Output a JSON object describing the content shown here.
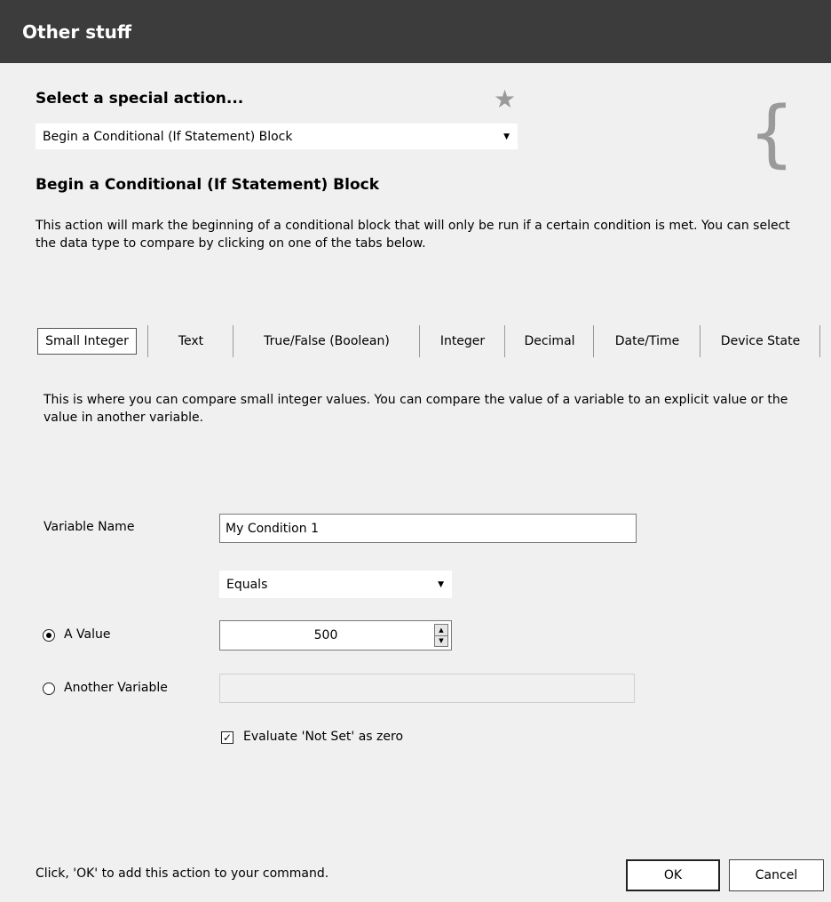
{
  "window": {
    "title": "Other stuff"
  },
  "action_select": {
    "heading": "Select a special action...",
    "value": "Begin a Conditional (If Statement) Block",
    "favorite_icon": "star-icon",
    "category_icon": "brace-icon",
    "category_glyph": "{"
  },
  "action": {
    "title": "Begin a Conditional (If Statement) Block",
    "description": "This action will mark the beginning of a conditional block that will only be run if a certain condition is met.  You can select the data type to compare by clicking on one of the tabs below."
  },
  "tabs": [
    {
      "label": "Small Integer",
      "active": true
    },
    {
      "label": "Text"
    },
    {
      "label": "True/False (Boolean)"
    },
    {
      "label": "Integer"
    },
    {
      "label": "Decimal"
    },
    {
      "label": "Date/Time"
    },
    {
      "label": "Device State"
    }
  ],
  "tab_panel": {
    "description": "This is where you can compare small integer values.  You can compare the value of a variable to an explicit value or the value in another variable.",
    "variable_name_label": "Variable Name",
    "variable_name_value": "My Condition 1",
    "operator_value": "Equals",
    "a_value_label": "A Value",
    "a_value": "500",
    "a_value_selected": true,
    "another_variable_label": "Another Variable",
    "another_variable_value": "",
    "evaluate_not_set_label": "Evaluate 'Not Set' as zero",
    "evaluate_not_set_checked": true
  },
  "footer": {
    "hint": "Click, 'OK' to add this action to your command.",
    "ok_label": "OK",
    "cancel_label": "Cancel"
  }
}
